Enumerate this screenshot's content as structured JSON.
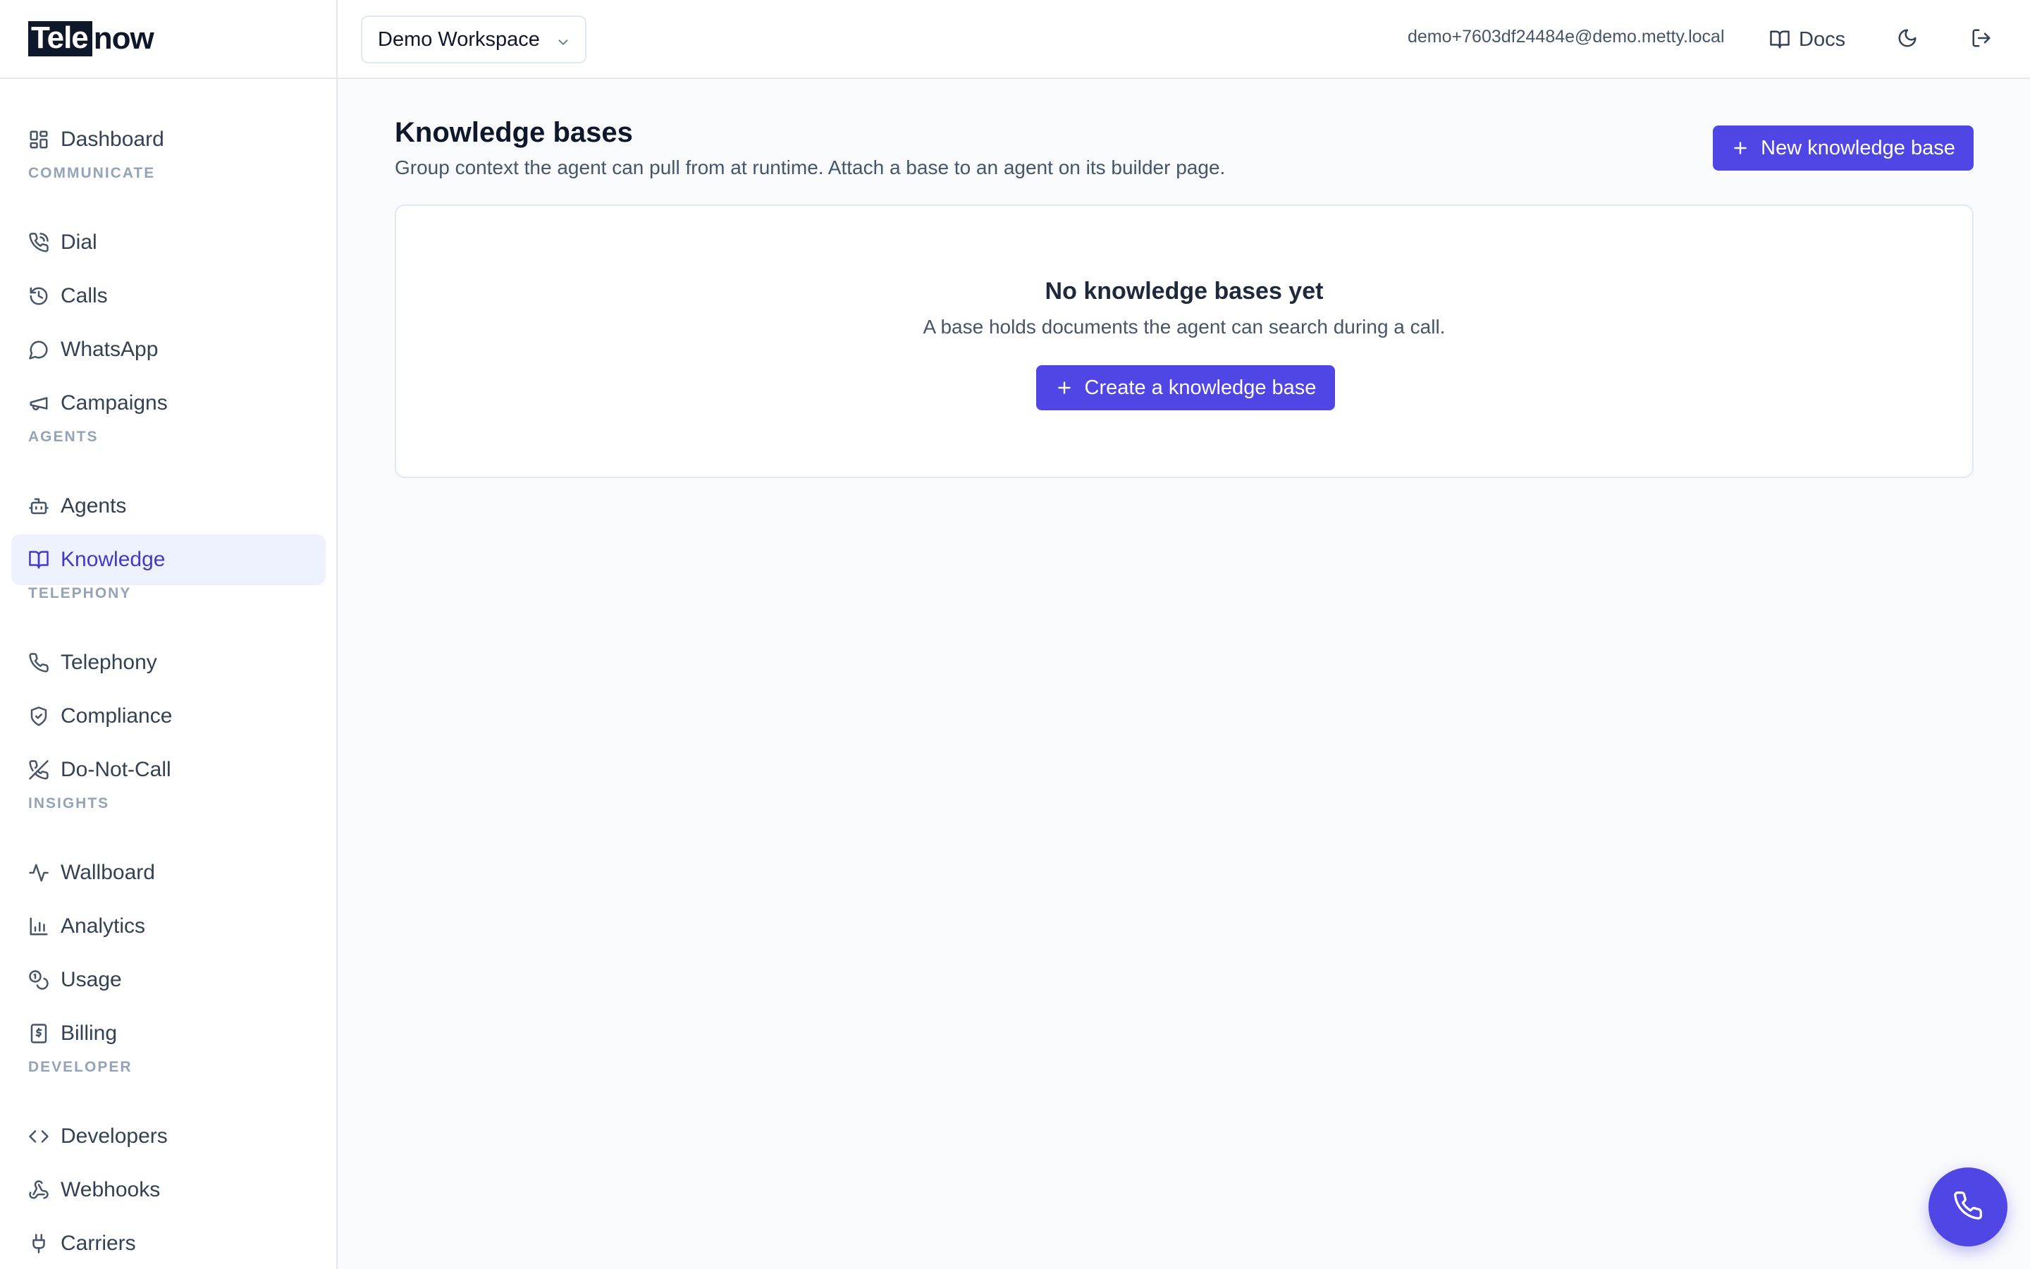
{
  "brand": {
    "part1": "Tele",
    "part2": "now"
  },
  "nav": {
    "dashboard": "Dashboard",
    "sections": {
      "communicate": "COMMUNICATE",
      "agents": "AGENTS",
      "telephony": "TELEPHONY",
      "insights": "INSIGHTS",
      "developer": "DEVELOPER"
    },
    "items": {
      "dial": "Dial",
      "calls": "Calls",
      "whatsapp": "WhatsApp",
      "campaigns": "Campaigns",
      "agents": "Agents",
      "knowledge": "Knowledge",
      "telephony": "Telephony",
      "compliance": "Compliance",
      "dnc": "Do-Not-Call",
      "wallboard": "Wallboard",
      "analytics": "Analytics",
      "usage": "Usage",
      "billing": "Billing",
      "developers": "Developers",
      "webhooks": "Webhooks",
      "carriers": "Carriers"
    },
    "active": "knowledge"
  },
  "topbar": {
    "workspace": "Demo Workspace",
    "user_email": "demo+7603df24484e@demo.metty.local",
    "docs": "Docs",
    "icons": [
      "moon-icon",
      "logout-icon"
    ]
  },
  "main": {
    "title": "Knowledge bases",
    "subtitle": "Group context the agent can pull from at runtime. Attach a base to an agent on its builder page.",
    "new_button": "New knowledge base",
    "empty": {
      "title": "No knowledge bases yet",
      "subtitle": "A base holds documents the agent can search during a call.",
      "button": "Create a knowledge base"
    }
  },
  "colors": {
    "accent": "#4f46e5",
    "active_bg": "#eef2ff",
    "active_text": "#4338ca"
  }
}
